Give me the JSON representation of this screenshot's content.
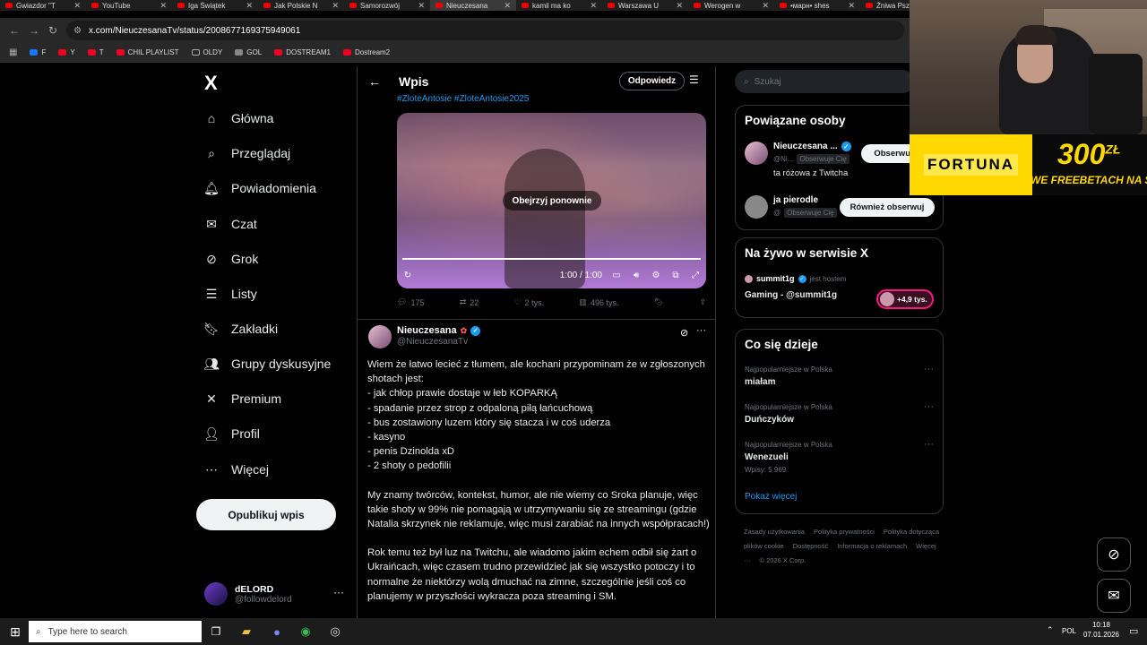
{
  "browser": {
    "tabs": [
      "Gwiazdor \"T",
      "YouTube",
      "Iga Świątek",
      "Jak Polskie N",
      "Samorozwój",
      "Nieuczesana",
      "kamil ma ko",
      "Warszawa U",
      "Werogen w",
      "•марн• shes",
      "Żniwa Pszen"
    ],
    "active_tab_index": 5,
    "url": "x.com/NieuczesanaTv/status/2008677169375949061",
    "bookmarks": [
      "F",
      "Y",
      "T",
      "CHIL PLAYLIST",
      "OLDY",
      "GOL",
      "DOSTREAM1",
      "Dostream2"
    ]
  },
  "nav": {
    "logo": "X",
    "items": [
      {
        "label": "Główna",
        "icon": "home-icon"
      },
      {
        "label": "Przeglądaj",
        "icon": "search-icon"
      },
      {
        "label": "Powiadomienia",
        "icon": "bell-icon"
      },
      {
        "label": "Czat",
        "icon": "mail-icon"
      },
      {
        "label": "Grok",
        "icon": "grok-icon"
      },
      {
        "label": "Listy",
        "icon": "list-icon"
      },
      {
        "label": "Zakładki",
        "icon": "bookmark-icon"
      },
      {
        "label": "Grupy dyskusyjne",
        "icon": "groups-icon"
      },
      {
        "label": "Premium",
        "icon": "x-icon"
      },
      {
        "label": "Profil",
        "icon": "person-icon"
      },
      {
        "label": "Więcej",
        "icon": "more-icon"
      }
    ],
    "post_button": "Opublikuj wpis",
    "account": {
      "name": "dELORD",
      "handle": "@followdelord"
    }
  },
  "center": {
    "title": "Wpis",
    "reply_button": "Odpowiedz",
    "hashtags": "#ZloteAntosie #ZloteAntosie2025",
    "video": {
      "overlay": "Obejrzyj ponownie",
      "time": "1:00 / 1:00"
    },
    "stats": {
      "replies": "175",
      "reposts": "22",
      "likes": "2 tys.",
      "views": "496 tys."
    },
    "reply": {
      "name": "Nieuczesana",
      "handle": "@NieuczesanaTv",
      "paragraphs": [
        "Wiem że łatwo lecieć z tłumem, ale kochani przypominam że w zgłoszonych shotach jest:\n- jak chłop prawie dostaje w łeb KOPARKĄ\n- spadanie przez strop z odpaloną piłą łańcuchową\n- bus zostawiony luzem który się stacza i w coś uderza\n- kasyno\n- penis Dzinolda xD\n- 2 shoty o pedofilii",
        "My znamy twórców, kontekst, humor, ale nie wiemy co Sroka planuje, więc takie shoty w 99% nie pomagają w utrzymywaniu się ze streamingu (gdzie Natalia skrzynek nie reklamuje, więc musi zarabiać na innych współpracach!)",
        "Rok temu też był luz na Twitchu, ale wiadomo jakim echem odbił się żart o Ukraińcach, więc czasem trudno przewidzieć jak się wszystko potoczy i to normalne że niektórzy wolą dmuchać na zimne, szczególnie jeśli coś co planujemy w przyszłości wykracza poza streaming i SM."
      ]
    }
  },
  "right": {
    "search_placeholder": "Szukaj",
    "related": {
      "title": "Powiązane osoby",
      "people": [
        {
          "name": "Nieuczesana ...",
          "handle": "@Ni...",
          "badge": "Obserwuje Cię",
          "bio": "ta różowa z Twitcha",
          "button": "Obserwuj"
        },
        {
          "name": "ja pierodle",
          "handle": "@",
          "badge": "Obserwuje Cię",
          "bio": "",
          "button": "Również obserwuj"
        }
      ]
    },
    "live": {
      "title": "Na żywo w serwisie X",
      "host": "summit1g",
      "host_suffix": "jest hostem",
      "show": "Gaming - @summit1g",
      "listeners": "+4,9 tys."
    },
    "trends": {
      "title": "Co się dzieje",
      "items": [
        {
          "context": "Najpopularniejsze w Polska",
          "title": "miałam",
          "count": ""
        },
        {
          "context": "Najpopularniejsze w Polska",
          "title": "Duńczyków",
          "count": ""
        },
        {
          "context": "Najpopularniejsze w Polska",
          "title": "Wenezueli",
          "count": "Wpisy: 5 969"
        }
      ],
      "show_more": "Pokaż więcej"
    },
    "footer": [
      "Zasady użytkowania",
      "Polityka prywatności",
      "Polityka dotycząca plików cookie",
      "Dostępność",
      "Informacja o reklamach",
      "Więcej ···",
      "© 2026 X Corp."
    ]
  },
  "ad": {
    "brand": "FORTUNA",
    "amount": "300",
    "currency": "ZŁ",
    "tagline": "WE FREEBETACH NA START"
  },
  "taskbar": {
    "search_placeholder": "Type here to search",
    "lang": "POL",
    "time": "10:18",
    "date": "07.01.2026"
  },
  "colors": {
    "accent": "#1d9bf0",
    "background": "#000000",
    "border": "#2f3336",
    "fortuna_yellow": "#ffd800"
  }
}
